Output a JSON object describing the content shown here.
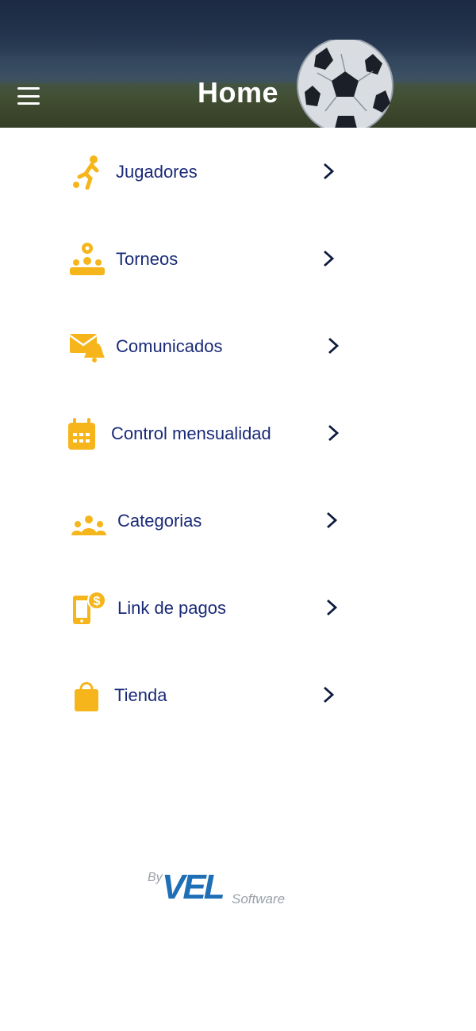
{
  "header": {
    "title": "Home"
  },
  "menu": [
    {
      "label": "Jugadores",
      "icon": "player-kick-icon"
    },
    {
      "label": "Torneos",
      "icon": "tournament-group-icon"
    },
    {
      "label": "Comunicados",
      "icon": "envelope-bell-icon"
    },
    {
      "label": "Control mensualidad",
      "icon": "calendar-icon"
    },
    {
      "label": "Categorias",
      "icon": "group-users-icon"
    },
    {
      "label": "Link de pagos",
      "icon": "phone-payment-icon"
    },
    {
      "label": "Tienda",
      "icon": "shopping-bag-icon"
    }
  ],
  "footer": {
    "by": "By",
    "brand": "VEL",
    "suffix": "Software"
  },
  "colors": {
    "accent": "#f5b51b",
    "text": "#1a2a78",
    "chevron": "#0d1a3f",
    "brand": "#1e6fb5"
  }
}
